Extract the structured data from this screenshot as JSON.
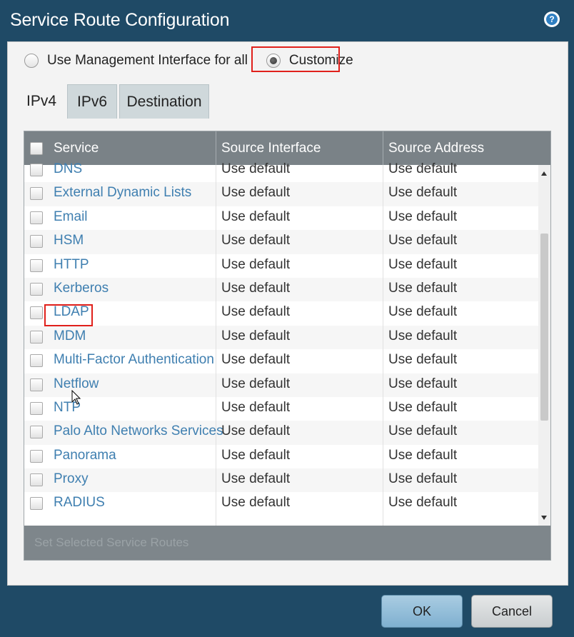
{
  "dialog": {
    "title": "Service Route Configuration",
    "help_icon": "question-circle-icon"
  },
  "options": {
    "use_mgmt_label": "Use Management Interface for all",
    "customize_label": "Customize",
    "selected": "Customize"
  },
  "tabs": [
    {
      "label": "IPv4",
      "active": true
    },
    {
      "label": "IPv6",
      "active": false
    },
    {
      "label": "Destination",
      "active": false
    }
  ],
  "table": {
    "columns": [
      "Service",
      "Source Interface",
      "Source Address"
    ],
    "rows": [
      {
        "service": "DNS",
        "source_interface": "Use default",
        "source_address": "Use default"
      },
      {
        "service": "External Dynamic Lists",
        "source_interface": "Use default",
        "source_address": "Use default"
      },
      {
        "service": "Email",
        "source_interface": "Use default",
        "source_address": "Use default"
      },
      {
        "service": "HSM",
        "source_interface": "Use default",
        "source_address": "Use default"
      },
      {
        "service": "HTTP",
        "source_interface": "Use default",
        "source_address": "Use default"
      },
      {
        "service": "Kerberos",
        "source_interface": "Use default",
        "source_address": "Use default"
      },
      {
        "service": "LDAP",
        "source_interface": "Use default",
        "source_address": "Use default"
      },
      {
        "service": "MDM",
        "source_interface": "Use default",
        "source_address": "Use default"
      },
      {
        "service": "Multi-Factor Authentication",
        "source_interface": "Use default",
        "source_address": "Use default"
      },
      {
        "service": "Netflow",
        "source_interface": "Use default",
        "source_address": "Use default"
      },
      {
        "service": "NTP",
        "source_interface": "Use default",
        "source_address": "Use default"
      },
      {
        "service": "Palo Alto Networks Services",
        "source_interface": "Use default",
        "source_address": "Use default"
      },
      {
        "service": "Panorama",
        "source_interface": "Use default",
        "source_address": "Use default"
      },
      {
        "service": "Proxy",
        "source_interface": "Use default",
        "source_address": "Use default"
      },
      {
        "service": "RADIUS",
        "source_interface": "Use default",
        "source_address": "Use default"
      }
    ],
    "footer_action": "Set Selected Service Routes"
  },
  "buttons": {
    "ok": "OK",
    "cancel": "Cancel"
  },
  "colors": {
    "frame": "#1f4a66",
    "header": "#7a8287",
    "link": "#3f7fb0",
    "highlight": "#e0201b"
  }
}
